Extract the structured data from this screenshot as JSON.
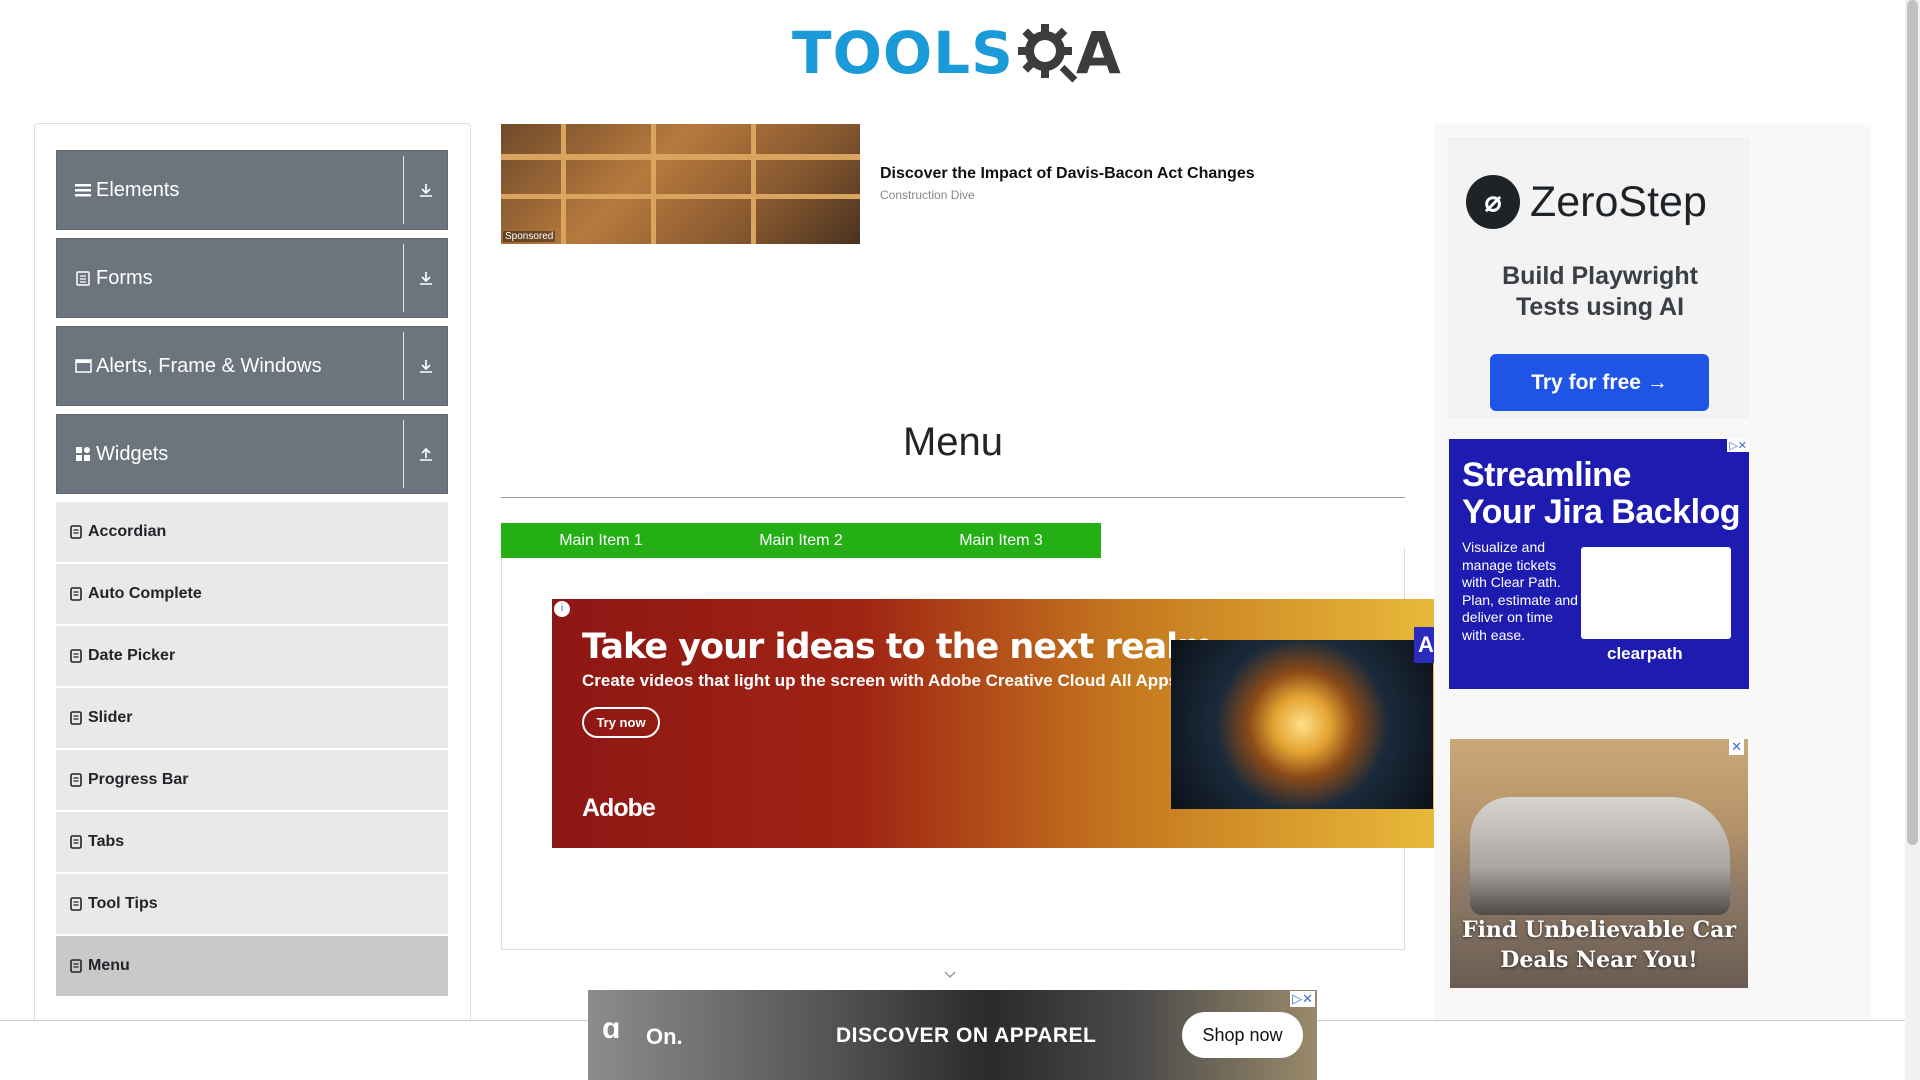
{
  "header": {
    "logo_tools": "TOOLS",
    "logo_qa": "A"
  },
  "sidebar": {
    "groups": [
      {
        "label": "Elements",
        "icon": "hamburger-icon",
        "toggle": "download-arrow-icon"
      },
      {
        "label": "Forms",
        "icon": "form-icon",
        "toggle": "download-arrow-icon"
      },
      {
        "label": "Alerts, Frame & Windows",
        "icon": "window-icon",
        "toggle": "download-arrow-icon"
      },
      {
        "label": "Widgets",
        "icon": "widgets-icon",
        "toggle": "upload-arrow-icon"
      }
    ],
    "items": [
      {
        "label": "Accordian"
      },
      {
        "label": "Auto Complete"
      },
      {
        "label": "Date Picker"
      },
      {
        "label": "Slider"
      },
      {
        "label": "Progress Bar"
      },
      {
        "label": "Tabs"
      },
      {
        "label": "Tool Tips"
      },
      {
        "label": "Menu",
        "active": true
      }
    ]
  },
  "sponsored": {
    "title": "Discover the Impact of Davis-Bacon Act Changes",
    "source": "Construction Dive",
    "tag": "Sponsored"
  },
  "main": {
    "title": "Menu",
    "menu_items": [
      "Main Item 1",
      "Main Item 2",
      "Main Item 3"
    ],
    "menu_color": "#24af15"
  },
  "ads": {
    "adobe": {
      "headline": "Take your ideas to the next realm.",
      "sub": "Create videos that light up the screen with Adobe Creative Cloud All Apps.",
      "button": "Try now",
      "logo": "Adobe",
      "tag": "Ac"
    },
    "on": {
      "logo": "On.",
      "text": "DISCOVER ON APPAREL",
      "button": "Shop now"
    },
    "zerostep": {
      "name": "ZeroStep",
      "tagline_1": "Build Playwright",
      "tagline_2": "Tests using AI",
      "button": "Try for free →"
    },
    "jira": {
      "headline_1": "Streamline",
      "headline_2": "Your Jira Backlog",
      "body": "Visualize and manage tickets with Clear Path. Plan, estimate and deliver on time with ease.",
      "logo": "clearpath"
    },
    "lexus": {
      "text_1": "Find Unbelievable Car",
      "text_2": "Deals Near You!"
    }
  }
}
